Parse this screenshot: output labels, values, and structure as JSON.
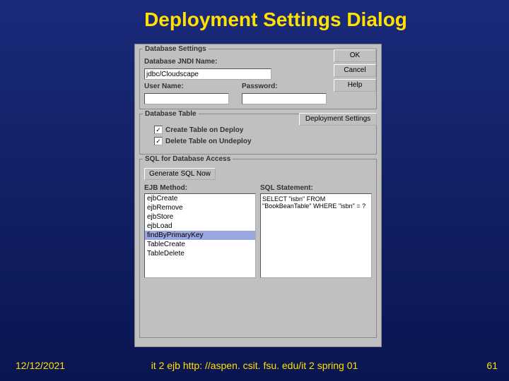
{
  "slide": {
    "title": "Deployment Settings Dialog",
    "date": "12/12/2021",
    "url": "it 2 ejb  http: //aspen. csit. fsu. edu/it 2 spring 01",
    "page": "61"
  },
  "dialog": {
    "db_settings": {
      "legend": "Database Settings",
      "jndi_label": "Database JNDI Name:",
      "jndi_value": "jdbc/Cloudscape",
      "user_label": "User Name:",
      "user_value": "",
      "pass_label": "Password:",
      "pass_value": ""
    },
    "buttons": {
      "ok": "OK",
      "cancel": "Cancel",
      "help": "Help"
    },
    "db_table": {
      "legend": "Database Table",
      "deploy_settings": "Deployment Settings",
      "create_label": "Create Table on Deploy",
      "create_checked": "✓",
      "delete_label": "Delete Table on Undeploy",
      "delete_checked": "✓"
    },
    "sql": {
      "legend": "SQL for Database Access",
      "generate": "Generate SQL Now",
      "ejb_label": "EJB Method:",
      "stmt_label": "SQL Statement:",
      "methods": [
        "ejbCreate",
        "ejbRemove",
        "ejbStore",
        "ejbLoad",
        "findByPrimaryKey",
        "TableCreate",
        "TableDelete"
      ],
      "selected_index": 4,
      "statement": "SELECT \"isbn\" FROM \"BookBeanTable\" WHERE \"isbn\" = ?"
    }
  }
}
